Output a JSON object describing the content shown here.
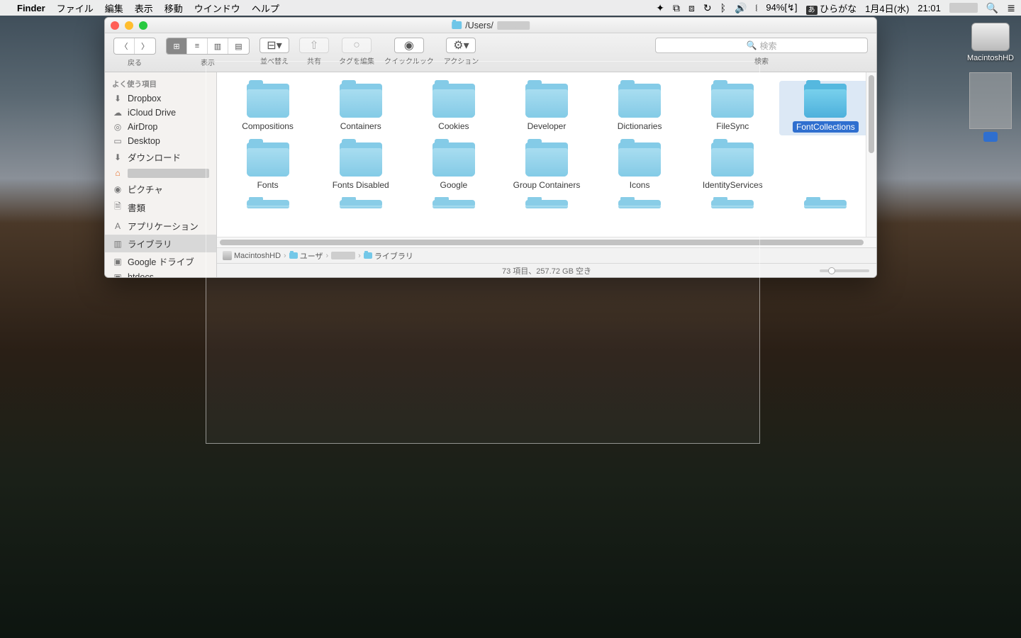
{
  "menubar": {
    "app": "Finder",
    "items": [
      "ファイル",
      "編集",
      "表示",
      "移動",
      "ウインドウ",
      "ヘルプ"
    ],
    "battery": "94%",
    "charging": "[↯]",
    "ime_badge": "あ",
    "ime": "ひらがな",
    "date": "1月4日(水)",
    "time": "21:01"
  },
  "window": {
    "title_prefix": "/Users/",
    "toolbar": {
      "back": "戻る",
      "view": "表示",
      "arrange": "並べ替え",
      "share": "共有",
      "tags": "タグを編集",
      "quicklook": "クイックルック",
      "action": "アクション",
      "search": "検索",
      "search_placeholder": "検索"
    },
    "sidebar": {
      "header": "よく使う項目",
      "items": [
        {
          "icon": "⬇",
          "label": "Dropbox"
        },
        {
          "icon": "☁",
          "label": "iCloud Drive"
        },
        {
          "icon": "◎",
          "label": "AirDrop"
        },
        {
          "icon": "▭",
          "label": "Desktop"
        },
        {
          "icon": "⬇",
          "label": "ダウンロード"
        },
        {
          "icon": "⌂",
          "label": "",
          "redacted": true,
          "active": true
        },
        {
          "icon": "◉",
          "label": "ピクチャ"
        },
        {
          "icon": "🗎",
          "label": "書類"
        },
        {
          "icon": "A",
          "label": "アプリケーション"
        },
        {
          "icon": "▥",
          "label": "ライブラリ",
          "selected": true
        },
        {
          "icon": "▣",
          "label": "Google ドライブ"
        },
        {
          "icon": "▣",
          "label": "htdocs"
        }
      ]
    },
    "folders_row1": [
      "Compositions",
      "Containers",
      "Cookies",
      "Developer",
      "Dictionaries",
      "FileSync",
      "FontCollections"
    ],
    "folders_row2": [
      "Fonts",
      "Fonts Disabled",
      "Google",
      "Group Containers",
      "Icons",
      "IdentityServices"
    ],
    "selected_folder": "FontCollections",
    "pathbar": [
      "MacintoshHD",
      "ユーザ",
      "",
      "ライブラリ"
    ],
    "status": "73 項目、257.72 GB 空き"
  },
  "desktop": {
    "disk_label": "MacintoshHD"
  }
}
